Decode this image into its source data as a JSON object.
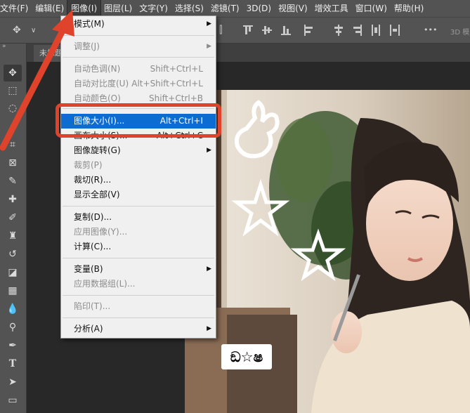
{
  "menubar": {
    "items": [
      "文件(F)",
      "编辑(E)",
      "图像(I)",
      "图层(L)",
      "文字(Y)",
      "选择(S)",
      "滤镜(T)",
      "3D(D)",
      "视图(V)",
      "增效工具",
      "窗口(W)",
      "帮助(H)"
    ],
    "active_index": 2
  },
  "optbar": {
    "more_label": "•••",
    "mode_label": "3D 模"
  },
  "tab": {
    "title": "未标题"
  },
  "image_menu": {
    "items": [
      {
        "label": "模式(M)",
        "shortcut": "",
        "submenu": true,
        "disabled": false
      },
      {
        "label": "调整(J)",
        "shortcut": "",
        "submenu": true,
        "disabled": true
      },
      {
        "label": "自动色调(N)",
        "shortcut": "Shift+Ctrl+L",
        "submenu": false,
        "disabled": true
      },
      {
        "label": "自动对比度(U)",
        "shortcut": "Alt+Shift+Ctrl+L",
        "submenu": false,
        "disabled": true
      },
      {
        "label": "自动颜色(O)",
        "shortcut": "Shift+Ctrl+B",
        "submenu": false,
        "disabled": true
      },
      {
        "label": "图像大小(I)...",
        "shortcut": "Alt+Ctrl+I",
        "submenu": false,
        "disabled": false,
        "highlighted": true
      },
      {
        "label": "画布大小(S)...",
        "shortcut": "Alt+Ctrl+C",
        "submenu": false,
        "disabled": false
      },
      {
        "label": "图像旋转(G)",
        "shortcut": "",
        "submenu": true,
        "disabled": false
      },
      {
        "label": "裁剪(P)",
        "shortcut": "",
        "submenu": false,
        "disabled": true
      },
      {
        "label": "裁切(R)...",
        "shortcut": "",
        "submenu": false,
        "disabled": false
      },
      {
        "label": "显示全部(V)",
        "shortcut": "",
        "submenu": false,
        "disabled": false
      },
      {
        "label": "复制(D)...",
        "shortcut": "",
        "submenu": false,
        "disabled": false
      },
      {
        "label": "应用图像(Y)...",
        "shortcut": "",
        "submenu": false,
        "disabled": true
      },
      {
        "label": "计算(C)...",
        "shortcut": "",
        "submenu": false,
        "disabled": false
      },
      {
        "label": "变量(B)",
        "shortcut": "",
        "submenu": true,
        "disabled": false
      },
      {
        "label": "应用数据组(L)...",
        "shortcut": "",
        "submenu": false,
        "disabled": true
      },
      {
        "label": "陷印(T)...",
        "shortcut": "",
        "submenu": false,
        "disabled": true
      },
      {
        "label": "分析(A)",
        "shortcut": "",
        "submenu": true,
        "disabled": false
      }
    ]
  },
  "sticker": {
    "text": "ඞ☆ෂ"
  },
  "colors": {
    "highlight": "#0d6cd1",
    "annotation": "#e0432b",
    "ui_panel": "#535353"
  }
}
